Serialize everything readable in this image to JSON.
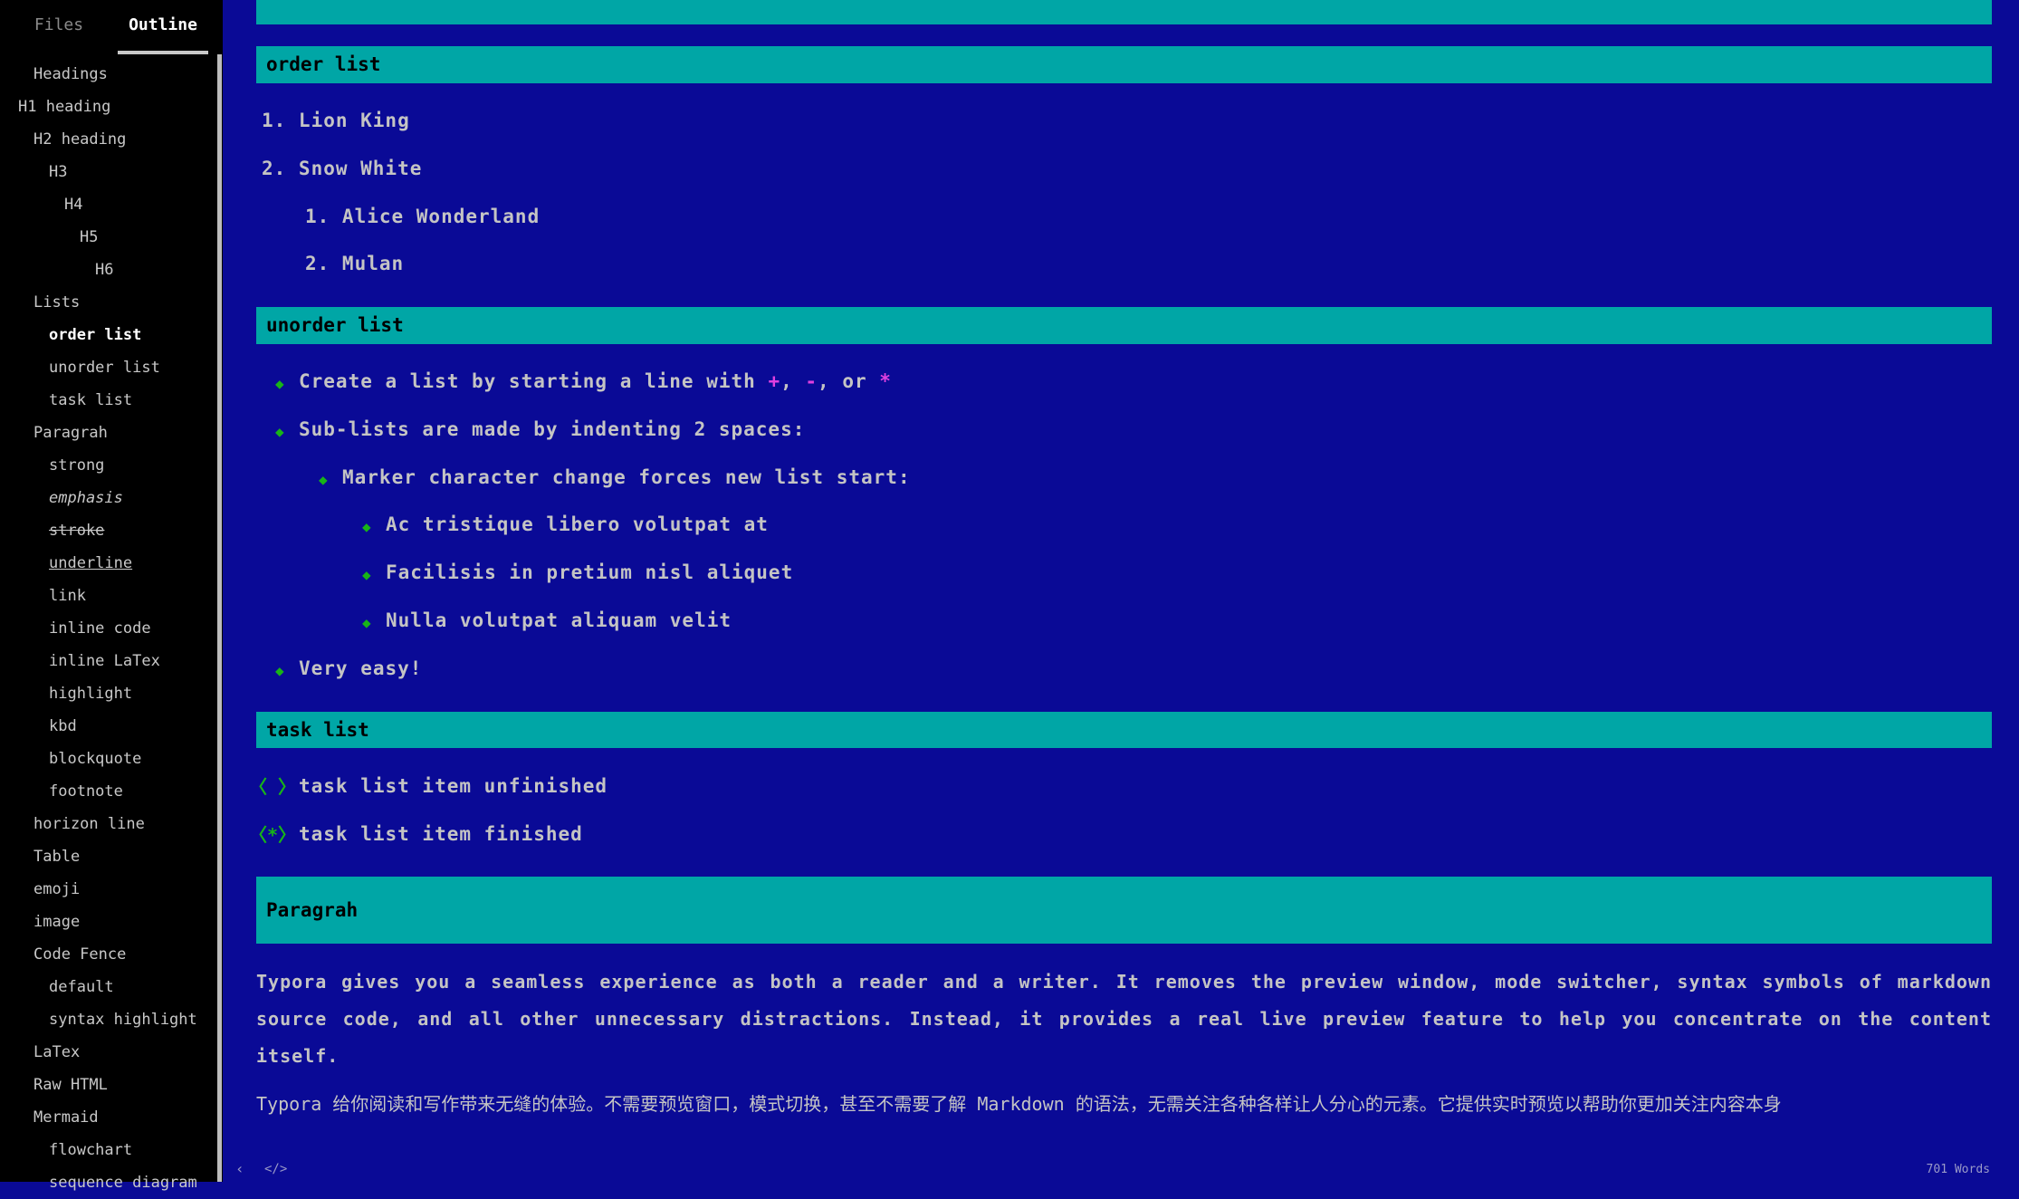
{
  "sidebar": {
    "tabs": {
      "files": "Files",
      "outline": "Outline"
    },
    "outline": [
      {
        "label": "Headings",
        "indent": 1
      },
      {
        "label": "H1 heading",
        "indent": 0
      },
      {
        "label": "H2 heading",
        "indent": 1
      },
      {
        "label": "H3",
        "indent": 2
      },
      {
        "label": "H4",
        "indent": 3
      },
      {
        "label": "H5",
        "indent": 4
      },
      {
        "label": "H6",
        "indent": 5
      },
      {
        "label": "Lists",
        "indent": 1
      },
      {
        "label": "order list",
        "indent": 2,
        "active": true
      },
      {
        "label": "unorder list",
        "indent": 2
      },
      {
        "label": "task list",
        "indent": 2
      },
      {
        "label": "Paragrah",
        "indent": 1
      },
      {
        "label": "strong",
        "indent": 2
      },
      {
        "label": "emphasis",
        "indent": 2,
        "style": "em"
      },
      {
        "label": "stroke",
        "indent": 2,
        "style": "strike"
      },
      {
        "label": "underline",
        "indent": 2,
        "style": "under"
      },
      {
        "label": "link",
        "indent": 2
      },
      {
        "label": "inline code",
        "indent": 2
      },
      {
        "label": "inline LaTex",
        "indent": 2
      },
      {
        "label": "highlight",
        "indent": 2
      },
      {
        "label": "kbd",
        "indent": 2
      },
      {
        "label": "blockquote",
        "indent": 2
      },
      {
        "label": "footnote",
        "indent": 2
      },
      {
        "label": "horizon line",
        "indent": 1
      },
      {
        "label": "Table",
        "indent": 1
      },
      {
        "label": "emoji",
        "indent": 1
      },
      {
        "label": "image",
        "indent": 1
      },
      {
        "label": "Code Fence",
        "indent": 1
      },
      {
        "label": "default",
        "indent": 2
      },
      {
        "label": "syntax highlight",
        "indent": 2
      },
      {
        "label": "LaTex",
        "indent": 1
      },
      {
        "label": "Raw HTML",
        "indent": 1
      },
      {
        "label": "Mermaid",
        "indent": 1
      },
      {
        "label": "flowchart",
        "indent": 2
      },
      {
        "label": "sequence diagram",
        "indent": 2
      }
    ]
  },
  "doc": {
    "order_list": {
      "heading": "order list",
      "items": [
        "1. Lion King",
        "2. Snow White"
      ],
      "sub_items": [
        "1. Alice Wonderland",
        "2. Mulan"
      ]
    },
    "unorder_list": {
      "heading": "unorder list",
      "item1_prefix": "Create a list by starting a line with ",
      "marker_plus": "+",
      "sep1": ", ",
      "marker_minus": "-",
      "sep2": ", or ",
      "marker_star": "*",
      "item2": "Sub-lists are made by indenting 2 spaces:",
      "item3": "Marker character change forces new list start:",
      "item4": "Ac tristique libero volutpat at",
      "item5": "Facilisis in pretium nisl aliquet",
      "item6": "Nulla volutpat aliquam velit",
      "item7": "Very easy!"
    },
    "task_list": {
      "heading": "task list",
      "unchecked_box": "〈 〉",
      "checked_box": "〈*〉",
      "item1": "task list item unfinished",
      "item2": "task list item finished"
    },
    "paragraph": {
      "heading": "Paragrah",
      "en": "Typora gives you a seamless experience as both a reader and a writer. It removes the preview window, mode switcher, syntax symbols of markdown  source code, and all other unnecessary distractions. Instead, it  provides a real live preview feature to help you concentrate on the  content itself.",
      "zh": "Typora 给你阅读和写作带来无缝的体验。不需要预览窗口，模式切换，甚至不需要了解 Markdown 的语法，无需关注各种各样让人分心的元素。它提供实时预览以帮助你更加关注内容本身"
    }
  },
  "status": {
    "word_count": "701 Words"
  }
}
